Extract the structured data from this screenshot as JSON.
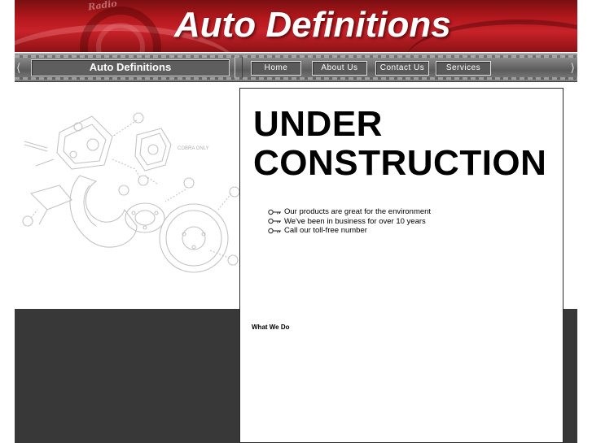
{
  "header": {
    "banner_title": "Auto Definitions",
    "banner_stamp": "Radio"
  },
  "navbar": {
    "site_label": "Auto Definitions",
    "links": [
      {
        "label": "Home"
      },
      {
        "label": "About Us"
      },
      {
        "label": "Contact Us"
      },
      {
        "label": "Services"
      }
    ]
  },
  "diagram": {
    "label": "COBRA ONLY",
    "icon": "brake-assembly-illustration"
  },
  "main": {
    "heading_line1": "UNDER",
    "heading_line2": "CONSTRUCTION",
    "bullets": [
      {
        "text": "Our products are great for the environment"
      },
      {
        "text": "We've been in business for over 10 years"
      },
      {
        "text": "Call our toll-free number"
      }
    ],
    "section_label": "What We Do"
  },
  "colors": {
    "banner_red": "#b3181c",
    "nav_gray": "#6f6f6f",
    "dark_panel": "#383838"
  }
}
